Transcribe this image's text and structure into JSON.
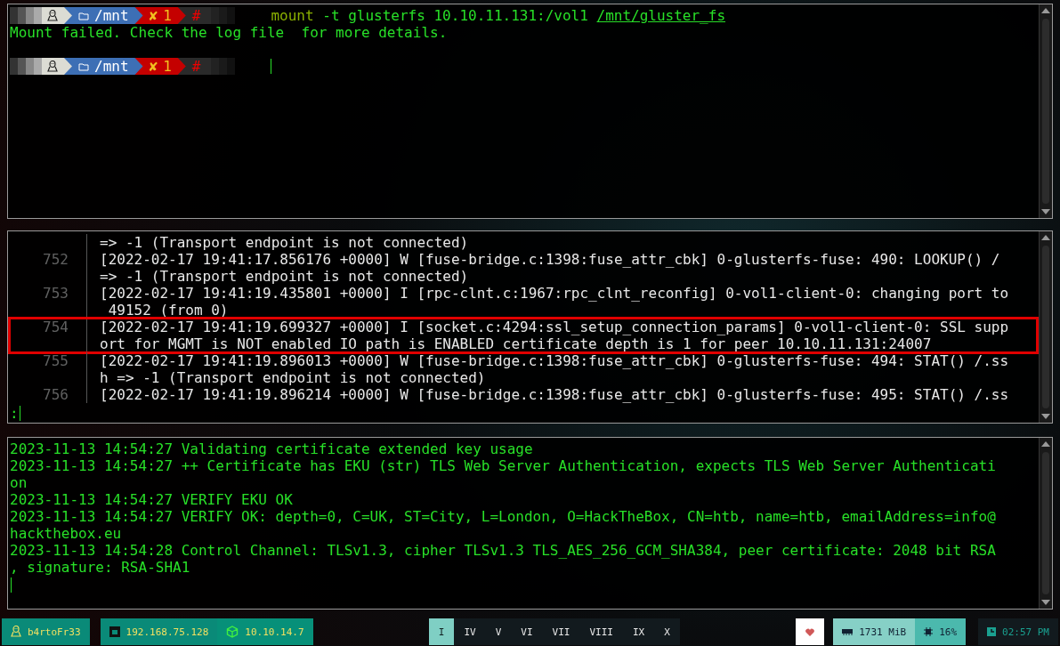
{
  "top_terminal": {
    "prompts": [
      {
        "path": "/mnt",
        "status": "✘",
        "exit_code": "1",
        "symbol": "#",
        "command": [
          {
            "kind": "program",
            "text": "mount"
          },
          {
            "kind": "arg",
            "text": " -t glusterfs 10.10.11.131:/vol1 "
          },
          {
            "kind": "path",
            "text": "/mnt/gluster_fs"
          }
        ],
        "output": "Mount failed. Check the log file  for more details.",
        "cursor": false
      },
      {
        "path": "/mnt",
        "status": "✘",
        "exit_code": "1",
        "symbol": "#",
        "cursor": true
      }
    ]
  },
  "log_viewer": {
    "entries": [
      {
        "lines": [
          "=> -1 (Transport endpoint is not connected)"
        ],
        "highlighted": false
      },
      {
        "number": "752",
        "lines": [
          "[2022-02-17 19:41:17.856176 +0000] W [fuse-bridge.c:1398:fuse_attr_cbk] 0-glusterfs-fuse: 490: LOOKUP() /",
          "=> -1 (Transport endpoint is not connected)"
        ],
        "highlighted": false
      },
      {
        "number": "753",
        "lines": [
          "[2022-02-17 19:41:19.435801 +0000] I [rpc-clnt.c:1967:rpc_clnt_reconfig] 0-vol1-client-0: changing port to",
          " 49152 (from 0)"
        ],
        "highlighted": false
      },
      {
        "number": "754",
        "lines": [
          "[2022-02-17 19:41:19.699327 +0000] I [socket.c:4294:ssl_setup_connection_params] 0-vol1-client-0: SSL supp",
          "ort for MGMT is NOT enabled IO path is ENABLED certificate depth is 1 for peer 10.10.11.131:24007"
        ],
        "highlighted": true
      },
      {
        "number": "755",
        "lines": [
          "[2022-02-17 19:41:19.896013 +0000] W [fuse-bridge.c:1398:fuse_attr_cbk] 0-glusterfs-fuse: 494: STAT() /.ss",
          "h => -1 (Transport endpoint is not connected)"
        ],
        "highlighted": false
      },
      {
        "number": "756",
        "lines": [
          "[2022-02-17 19:41:19.896214 +0000] W [fuse-bridge.c:1398:fuse_attr_cbk] 0-glusterfs-fuse: 495: STAT() /.ss"
        ],
        "highlighted": false
      }
    ],
    "pager_prompt": ":"
  },
  "bottom_terminal": {
    "lines": [
      "2023-11-13 14:54:27 Validating certificate extended key usage",
      "2023-11-13 14:54:27 ++ Certificate has EKU (str) TLS Web Server Authentication, expects TLS Web Server Authenticati",
      "on",
      "2023-11-13 14:54:27 VERIFY EKU OK",
      "2023-11-13 14:54:27 VERIFY OK: depth=0, C=UK, ST=City, L=London, O=HackTheBox, CN=htb, name=htb, emailAddress=info@",
      "hackthebox.eu",
      "2023-11-13 14:54:28 Control Channel: TLSv1.3, cipher TLSv1.3 TLS_AES_256_GCM_SHA384, peer certificate: 2048 bit RSA",
      ", signature: RSA-SHA1"
    ]
  },
  "taskbar": {
    "user": "b4rtoFr33",
    "local_ip": "192.168.75.128",
    "vpn_ip": "10.10.14.7",
    "workspaces": [
      {
        "label": "I",
        "selected": true
      },
      {
        "label": "IV",
        "selected": false
      },
      {
        "label": "V",
        "selected": false
      },
      {
        "label": "VI",
        "selected": false
      },
      {
        "label": "VII",
        "selected": false
      },
      {
        "label": "VIII",
        "selected": false
      },
      {
        "label": "IX",
        "selected": false
      },
      {
        "label": "X",
        "selected": false
      }
    ],
    "memory": "1731 MiB",
    "cpu": "16%",
    "clock": "02:57 PM"
  }
}
